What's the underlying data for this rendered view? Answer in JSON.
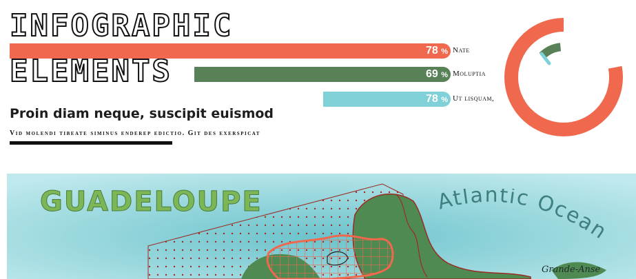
{
  "header": {
    "title_line1": "INFOGRAPHIC",
    "title_line2": "ELEMENTS",
    "subtitle": "Proin diam neque, suscipit euismod",
    "caption": "Vid molendi tibeate siminus enderep edictio. Git des exerspicat"
  },
  "bars": [
    {
      "percent": 78,
      "pct_text": "78",
      "unit": "%",
      "label": "Nate",
      "color": "#f0684d"
    },
    {
      "percent": 69,
      "pct_text": "69",
      "unit": "%",
      "label": "Moluptia",
      "color": "#588157"
    },
    {
      "percent": 78,
      "pct_text": "78",
      "unit": "%",
      "label": "Ut lisquam,",
      "color": "#7fd0d7"
    }
  ],
  "donut": {
    "outer_color": "#f0684d",
    "mid_color": "#588157",
    "inner_color": "#7fd0d7"
  },
  "map": {
    "title": "GUADELOUPE",
    "ocean_label": "Atlantic Ocean",
    "town_label": "Grande-Anse",
    "colors": {
      "sea": "#7fcfd6",
      "land": "#4f8a52",
      "hatch": "#f0684d",
      "border": "#9c2a22"
    }
  }
}
